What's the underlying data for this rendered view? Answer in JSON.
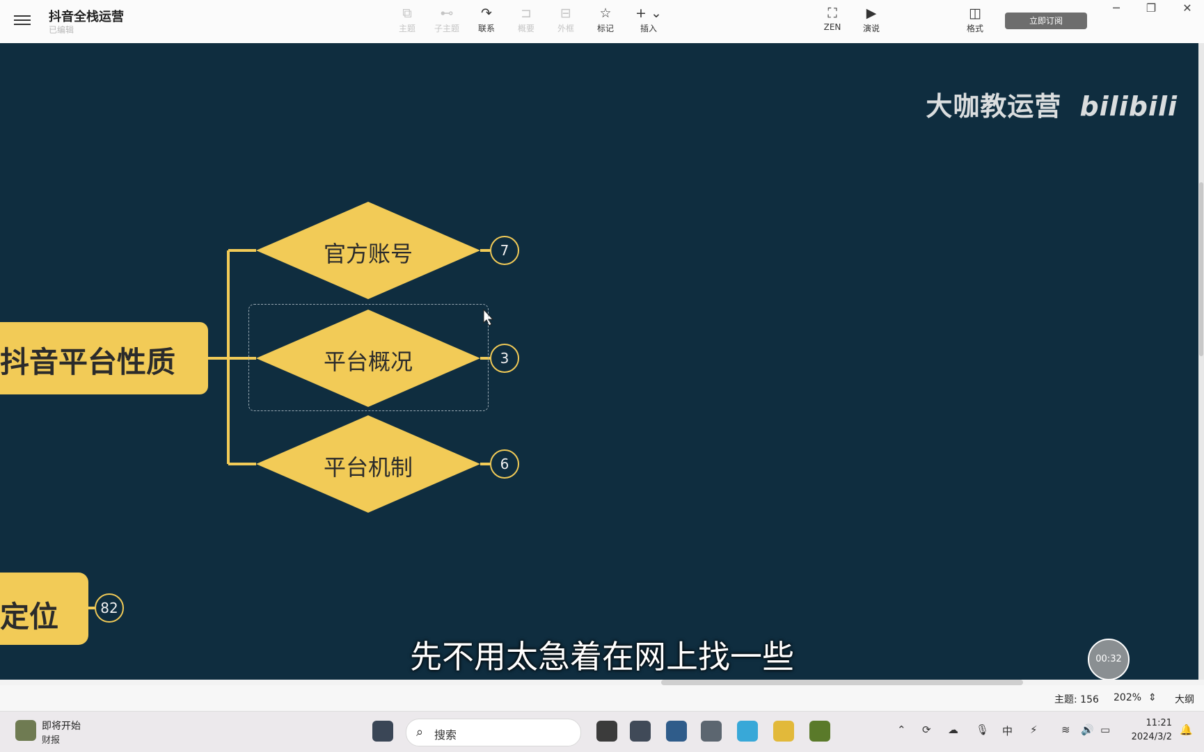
{
  "app": {
    "title": "抖音全栈运营",
    "status": "已编辑"
  },
  "toolbar": {
    "items": [
      {
        "icon": "topic-icon",
        "glyph": "⧉",
        "label": "主题",
        "enabled": false
      },
      {
        "icon": "subtopic-icon",
        "glyph": "⊷",
        "label": "子主题",
        "enabled": false
      },
      {
        "icon": "relationship-icon",
        "glyph": "↷",
        "label": "联系",
        "enabled": true
      },
      {
        "icon": "summary-icon",
        "glyph": "⊐",
        "label": "概要",
        "enabled": false
      },
      {
        "icon": "boundary-icon",
        "glyph": "⊟",
        "label": "外框",
        "enabled": false
      },
      {
        "icon": "marker-icon",
        "glyph": "☆",
        "label": "标记",
        "enabled": true
      },
      {
        "icon": "insert-icon",
        "glyph": "+ ⌄",
        "label": "插入",
        "enabled": true
      },
      {
        "icon": "zen-icon",
        "glyph": "⛶",
        "label": "ZEN",
        "enabled": true
      },
      {
        "icon": "present-icon",
        "glyph": "▶",
        "label": "演说",
        "enabled": true
      },
      {
        "icon": "format-icon",
        "glyph": "◫",
        "label": "格式",
        "enabled": true
      }
    ],
    "subscribe_label": "立即订阅"
  },
  "window_controls": {
    "minimize": "─",
    "restore": "❐",
    "close": "✕"
  },
  "canvas": {
    "background": "#0f2d3f",
    "node_color": "#f2cb57",
    "watermark_text": "大咖教运营",
    "watermark_logo": "bilibili",
    "root_topic": "抖音平台性质",
    "side_topic": "定位",
    "side_topic_count": "82",
    "branches": [
      {
        "label": "官方账号",
        "count": "7"
      },
      {
        "label": "平台概况",
        "count": "3",
        "selected": true
      },
      {
        "label": "平台机制",
        "count": "6"
      }
    ],
    "subtitle": "先不用太急着在网上找一些",
    "timer_text": "00:32"
  },
  "statusbar": {
    "topic_count_label": "主题: 156",
    "zoom": "202%",
    "outline_label": "大纲"
  },
  "taskbar": {
    "weather_title": "即将开始",
    "weather_sub": "财报",
    "search_placeholder": "搜索",
    "time": "11:21",
    "date": "2024/3/2"
  }
}
